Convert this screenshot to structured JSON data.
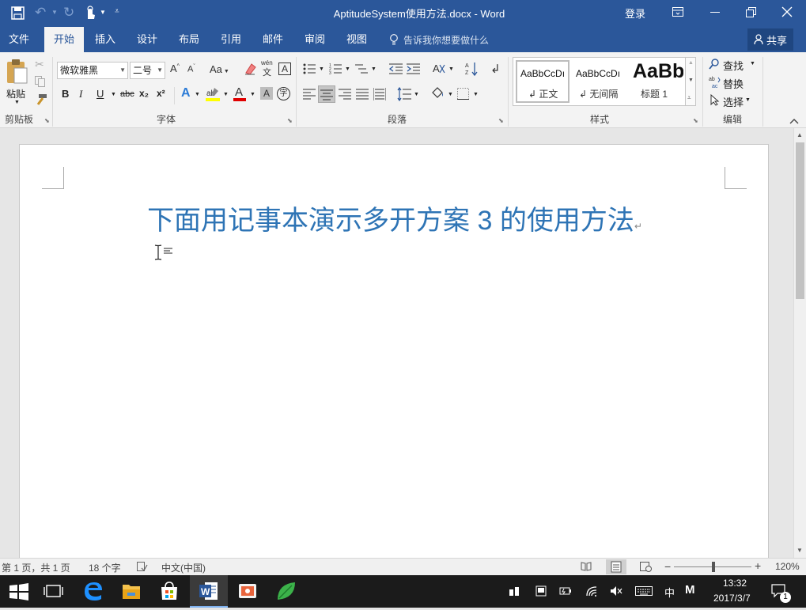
{
  "titlebar": {
    "document_title": "AptitudeSystem使用方法.docx  -  Word",
    "login_label": "登录"
  },
  "tabs": [
    {
      "label": "文件"
    },
    {
      "label": "开始"
    },
    {
      "label": "插入"
    },
    {
      "label": "设计"
    },
    {
      "label": "布局"
    },
    {
      "label": "引用"
    },
    {
      "label": "邮件"
    },
    {
      "label": "审阅"
    },
    {
      "label": "视图"
    }
  ],
  "tell_me": "告诉我你想要做什么",
  "share_label": "共享",
  "ribbon": {
    "paste_label": "粘贴",
    "clipboard_label": "剪贴板",
    "font_name": "微软雅黑",
    "font_size": "二号",
    "font_group_label": "字体",
    "paragraph_group_label": "段落",
    "styles_group_label": "样式",
    "editing_group_label": "编辑",
    "change_case_label": "Aa",
    "wen_label": "wén",
    "wen_sub": "文",
    "bold": "B",
    "italic": "I",
    "underline": "U",
    "strike": "abc",
    "subscript": "x₂",
    "superscript": "x²",
    "styles": [
      {
        "preview": "AaBbCcDı",
        "name": "↲ 正文"
      },
      {
        "preview": "AaBbCcDı",
        "name": "↲ 无间隔"
      },
      {
        "preview": "AaBb",
        "name": "标题 1"
      }
    ],
    "find_label": "查找",
    "replace_label": "替换",
    "select_label": "选择"
  },
  "document": {
    "heading": "下面用记事本演示多开方案 3 的使用方法"
  },
  "statusbar": {
    "page_info": "第 1 页，共 1 页",
    "word_count": "18 个字",
    "language": "中文(中国)",
    "zoom": "120%"
  },
  "taskbar": {
    "ime_label": "中",
    "ime_mode": "M",
    "time": "13:32",
    "date": "2017/3/7",
    "notification_count": "1"
  },
  "colors": {
    "word_blue": "#2b579a",
    "heading_blue": "#2e74b5"
  }
}
